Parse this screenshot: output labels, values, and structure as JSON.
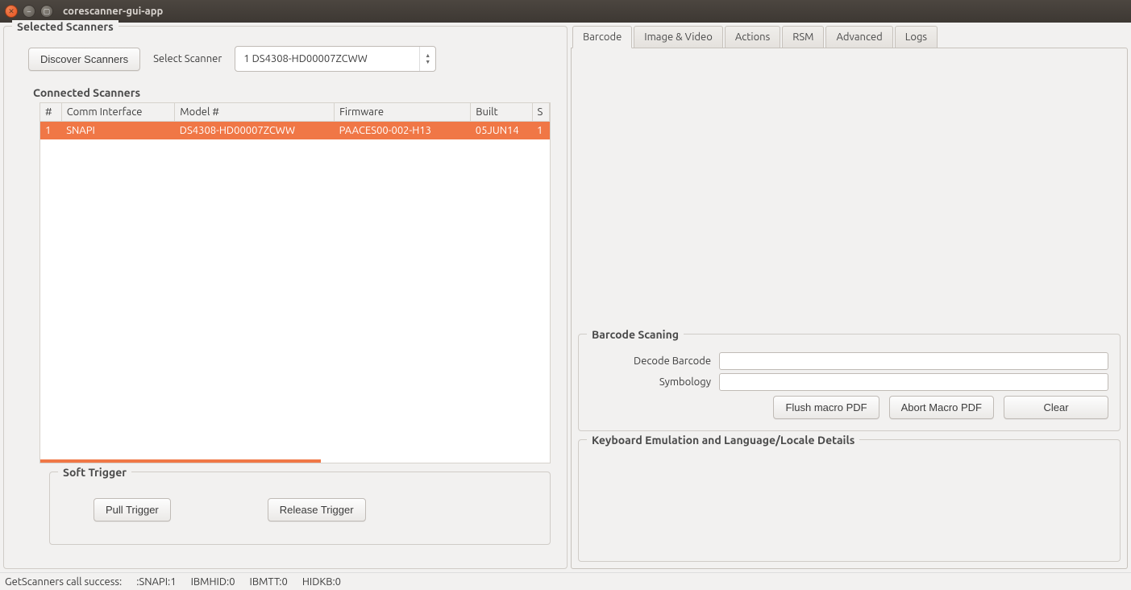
{
  "window": {
    "title": "corescanner-gui-app"
  },
  "selected_scanners": {
    "title": "Selected Scanners",
    "discover_btn": "Discover Scanners",
    "select_label": "Select Scanner",
    "select_value": "1      DS4308-HD00007ZCWW",
    "connected_title": "Connected Scanners",
    "columns": [
      "#",
      "Comm Interface",
      "Model #",
      "Firmware",
      "Built",
      "S"
    ],
    "rows": [
      {
        "num": "1",
        "comm": "SNAPI",
        "model": "DS4308-HD00007ZCWW",
        "firmware": "PAACES00-002-H13",
        "built": "05JUN14",
        "s": "1"
      }
    ]
  },
  "soft_trigger": {
    "title": "Soft Trigger",
    "pull": "Pull Trigger",
    "release": "Release Trigger"
  },
  "tabs": {
    "barcode": "Barcode",
    "image_video": "Image & Video",
    "actions": "Actions",
    "rsm": "RSM",
    "advanced": "Advanced",
    "logs": "Logs"
  },
  "barcode_panel": {
    "scan_title": "Barcode Scaning",
    "decode_label": "Decode Barcode",
    "decode_value": "",
    "symbology_label": "Symbology",
    "symbology_value": "",
    "flush_btn": "Flush macro PDF",
    "abort_btn": "Abort Macro PDF",
    "clear_btn": "Clear",
    "kb_title": "Keyboard Emulation and Language/Locale Details"
  },
  "status": {
    "msg": "GetScanners call success:",
    "snapi": ":SNAPI:1",
    "ibmhid": "IBMHID:0",
    "ibmtt": "IBMTT:0",
    "hidkb": "HIDKB:0"
  }
}
